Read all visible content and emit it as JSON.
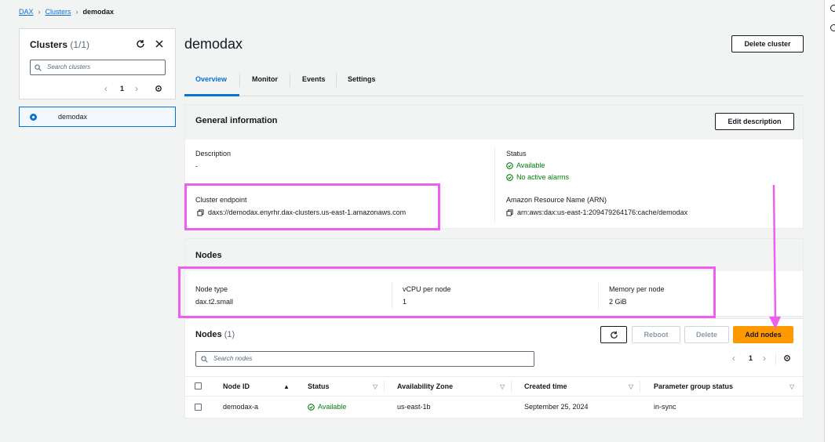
{
  "breadcrumb": {
    "root": "DAX",
    "parent": "Clusters",
    "current": "demodax"
  },
  "sidebar": {
    "title": "Clusters",
    "count": "(1/1)",
    "search_placeholder": "Search clusters",
    "page": "1",
    "items": [
      {
        "label": "demodax",
        "selected": true
      }
    ]
  },
  "header": {
    "title": "demodax",
    "delete_label": "Delete cluster"
  },
  "tabs": [
    "Overview",
    "Monitor",
    "Events",
    "Settings"
  ],
  "general": {
    "title": "General information",
    "edit_label": "Edit description",
    "description_label": "Description",
    "description_value": "-",
    "status_label": "Status",
    "status_available": "Available",
    "status_alarms": "No active alarms",
    "endpoint_label": "Cluster endpoint",
    "endpoint_value": "daxs://demodax.enyrhr.dax-clusters.us-east-1.amazonaws.com",
    "arn_label": "Amazon Resource Name (ARN)",
    "arn_value": "arn:aws:dax:us-east-1:209479264176:cache/demodax"
  },
  "nodes_info": {
    "title": "Nodes",
    "node_type_label": "Node type",
    "node_type_value": "dax.t2.small",
    "vcpu_label": "vCPU per node",
    "vcpu_value": "1",
    "memory_label": "Memory per node",
    "memory_value": "2 GiB"
  },
  "nodes_table": {
    "title": "Nodes",
    "count": "(1)",
    "reboot_label": "Reboot",
    "delete_label": "Delete",
    "add_label": "Add nodes",
    "search_placeholder": "Search nodes",
    "page": "1",
    "columns": [
      "Node ID",
      "Status",
      "Availability Zone",
      "Created time",
      "Parameter group status"
    ],
    "rows": [
      {
        "node_id": "demodax-a",
        "status": "Available",
        "az": "us-east-1b",
        "created": "September 25, 2024",
        "param_status": "in-sync"
      }
    ]
  },
  "colors": {
    "accent": "#0972d3",
    "primary": "#ff9900",
    "success": "#037f0c",
    "annotation": "#ee5ff1"
  }
}
